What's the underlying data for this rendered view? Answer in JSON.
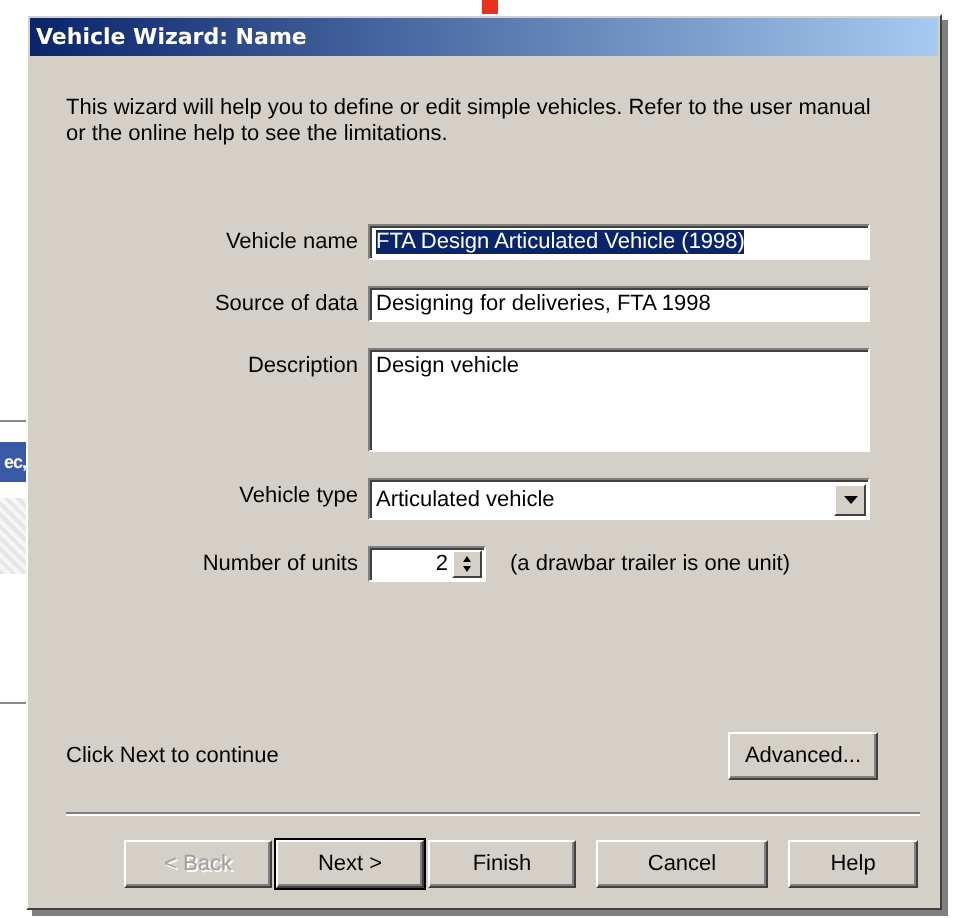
{
  "background_window": {
    "title": "ec,"
  },
  "window": {
    "title": "Vehicle Wizard: Name"
  },
  "intro": "This wizard will help you to define or edit simple vehicles.  Refer to the user manual or the online help to see the limitations.",
  "fields": [
    {
      "kind": "text",
      "label": "Vehicle name",
      "value": "FTA Design Articulated Vehicle (1998)",
      "selected": true
    },
    {
      "kind": "text",
      "label": "Source of data",
      "value": "Designing for deliveries, FTA 1998",
      "selected": false
    },
    {
      "kind": "textarea",
      "label": "Description",
      "value": "Design vehicle",
      "selected": false
    },
    {
      "kind": "dropdown",
      "label": "Vehicle type",
      "value": "Articulated vehicle",
      "selected": false
    },
    {
      "kind": "spinner",
      "label": "Number of units",
      "value": "2",
      "note": "(a drawbar trailer is one unit)",
      "selected": false
    }
  ],
  "footer_hint": "Click Next to continue",
  "advanced_button": "Advanced...",
  "buttons": [
    {
      "label": "< Back",
      "disabled": true,
      "default": false
    },
    {
      "label": "Next >",
      "disabled": false,
      "default": true
    },
    {
      "label": "Finish",
      "disabled": false,
      "default": false
    },
    {
      "label": "Cancel",
      "disabled": false,
      "default": false
    },
    {
      "label": "Help",
      "disabled": false,
      "default": false
    }
  ]
}
